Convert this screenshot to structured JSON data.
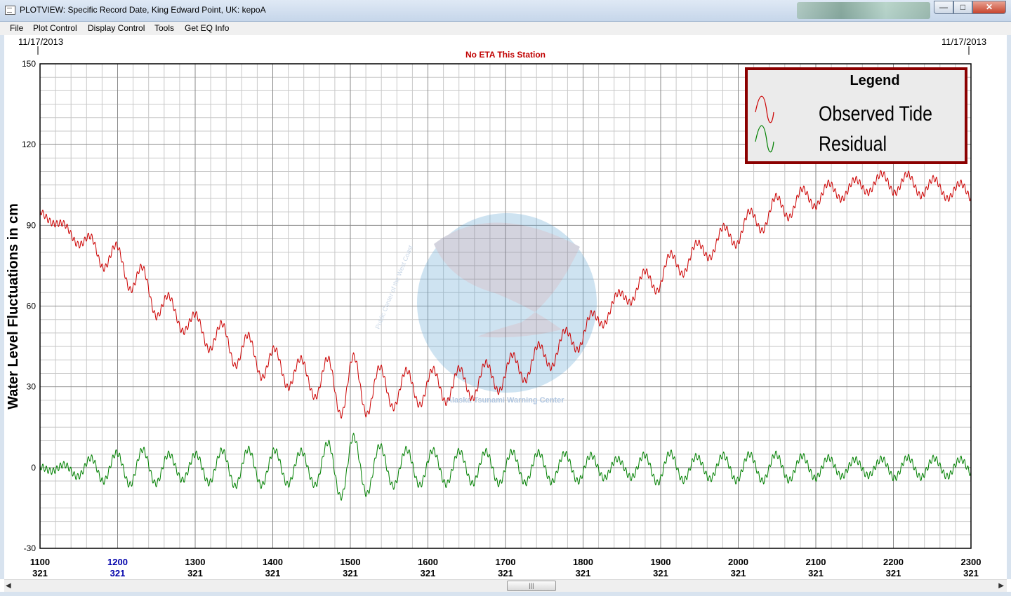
{
  "window": {
    "title": "PLOTVIEW: Specific Record Date, King Edward Point, UK: kepoA",
    "buttons": {
      "minimize": "—",
      "maximize": "□",
      "close": "✕"
    }
  },
  "menu": [
    "File",
    "Plot Control",
    "Display Control",
    "Tools",
    "Get EQ Info"
  ],
  "plot": {
    "date_left": "11/17/2013",
    "date_right": "11/17/2013",
    "eta_text": "No ETA This Station",
    "eta_color": "#c00000",
    "observed_color": "#cc0000",
    "residual_color": "#008000",
    "legend_border_color": "#8b0000"
  },
  "legend": {
    "title": "Legend",
    "entries": [
      "Observed Tide",
      "Residual"
    ]
  },
  "watermark": {
    "arc_text": "Alaska Tsunami Warning Center",
    "left_text": "Public Center of the West Coast"
  },
  "chart_data": {
    "type": "line",
    "ylabel": "Water Level Fluctuations in cm",
    "ylim": [
      -30,
      150
    ],
    "y_ticks": [
      150,
      120,
      90,
      60,
      30,
      0,
      -30
    ],
    "xlim": [
      1100,
      2300
    ],
    "x_ticks": [
      {
        "time": "1100",
        "day": "321"
      },
      {
        "time": "1200",
        "day": "321"
      },
      {
        "time": "1300",
        "day": "321"
      },
      {
        "time": "1400",
        "day": "321"
      },
      {
        "time": "1500",
        "day": "321"
      },
      {
        "time": "1600",
        "day": "321"
      },
      {
        "time": "1700",
        "day": "321"
      },
      {
        "time": "1800",
        "day": "321"
      },
      {
        "time": "1900",
        "day": "321"
      },
      {
        "time": "2000",
        "day": "321"
      },
      {
        "time": "2100",
        "day": "321"
      },
      {
        "time": "2200",
        "day": "321"
      },
      {
        "time": "2300",
        "day": "321"
      }
    ],
    "highlight_tick_index": 1,
    "grid": true,
    "legend_position": "top-right",
    "series": [
      {
        "name": "Observed Tide",
        "color": "#cc0000",
        "x_hours": [
          11.0,
          11.5,
          11.75,
          12.0,
          12.25,
          12.5,
          12.75,
          13.0,
          13.5,
          14.0,
          14.5,
          14.75,
          15.0,
          15.5,
          16.0,
          16.5,
          17.0,
          17.5,
          18.0,
          18.5,
          19.0,
          19.5,
          20.0,
          20.5,
          21.0,
          21.5,
          21.8,
          22.0,
          22.5,
          23.0
        ],
        "baseline": [
          95,
          85,
          80,
          77,
          70,
          62,
          57,
          52,
          45,
          38,
          33,
          31,
          30,
          29,
          30,
          31,
          35,
          41,
          50,
          63,
          72,
          80,
          88,
          96,
          101,
          104,
          106,
          106,
          104,
          102
        ],
        "oscillation_amp": [
          0.5,
          2.5,
          5,
          5.5,
          7,
          6,
          4.5,
          5,
          7,
          6.5,
          6,
          10,
          12,
          7,
          6.5,
          6,
          6,
          5.5,
          5,
          3,
          6,
          4,
          5,
          5,
          4,
          3,
          3,
          4,
          3.5,
          3
        ]
      },
      {
        "name": "Residual",
        "color": "#008000",
        "x_hours": [
          11.0,
          11.5,
          11.75,
          12.0,
          12.25,
          12.5,
          12.75,
          13.0,
          13.5,
          14.0,
          14.5,
          14.75,
          15.0,
          15.5,
          16.0,
          16.5,
          17.0,
          17.5,
          18.0,
          18.5,
          19.0,
          19.5,
          20.0,
          20.5,
          21.0,
          21.5,
          21.8,
          22.0,
          22.5,
          23.0
        ],
        "baseline": [
          0,
          -1,
          0,
          0,
          0,
          0,
          0,
          0,
          0,
          0,
          0,
          0,
          0,
          0,
          0,
          0,
          0,
          0,
          0,
          0,
          0,
          0,
          0,
          0,
          0,
          0,
          0,
          0,
          0,
          0
        ],
        "oscillation_amp": [
          0.5,
          2.5,
          5,
          5.5,
          7,
          6,
          4.5,
          5,
          7,
          6.5,
          6,
          10,
          12,
          7,
          6.5,
          6,
          6,
          5.5,
          5,
          3,
          6,
          4,
          5,
          5,
          4,
          3,
          3,
          4,
          3.5,
          3
        ]
      }
    ]
  },
  "scrollbar": {
    "left_arrow": "◀",
    "right_arrow": "▶",
    "thumb": "|||"
  }
}
